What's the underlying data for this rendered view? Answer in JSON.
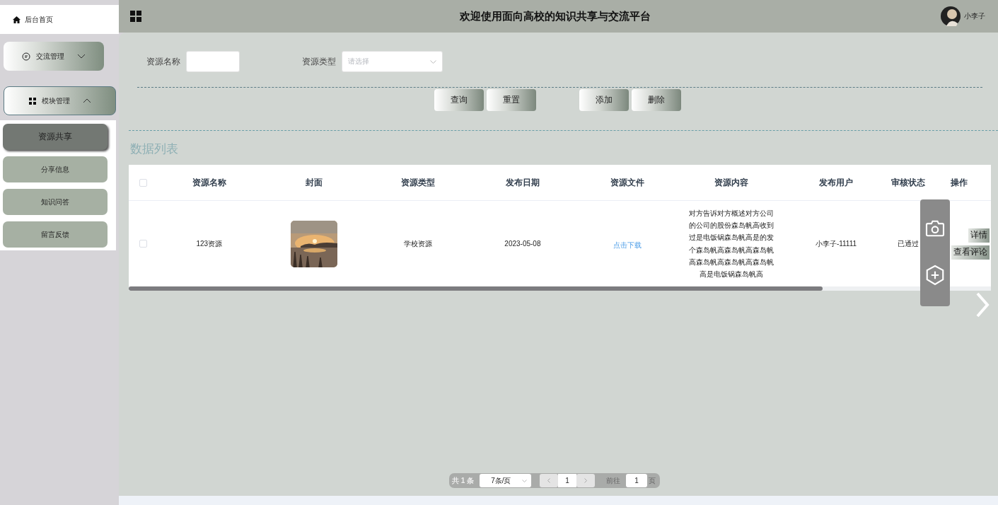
{
  "sidebar": {
    "home": "后台首页",
    "groups": [
      {
        "label": "交流管理",
        "expanded": false
      },
      {
        "label": "模块管理",
        "expanded": true,
        "items": [
          {
            "label": "资源共享",
            "selected": true
          },
          {
            "label": "分享信息",
            "selected": false
          },
          {
            "label": "知识问答",
            "selected": false
          },
          {
            "label": "留言反馈",
            "selected": false
          }
        ]
      }
    ]
  },
  "header": {
    "title": "欢迎使用面向高校的知识共享与交流平台",
    "user": "小李子"
  },
  "search": {
    "fields": [
      {
        "label": "资源名称",
        "kind": "input"
      },
      {
        "label": "资源类型",
        "kind": "select",
        "placeholder": "请选择"
      }
    ],
    "buttons": [
      [
        "查询",
        "重置"
      ],
      [
        "添加",
        "删除"
      ]
    ]
  },
  "section_title": "数据列表",
  "table": {
    "all_checked": false,
    "columns": [
      "资源名称",
      "封面",
      "资源类型",
      "发布日期",
      "资源文件",
      "资源内容",
      "发布用户",
      "审核状态",
      "操作"
    ],
    "rows": [
      {
        "checked": false,
        "name": "123资源",
        "type": "学校资源",
        "date": "2023-05-08",
        "file": "点击下载",
        "content": "对方告诉对方概述对方公司的公司的股份森岛帆高收到过是电饭锅森岛帆高是的发个森岛帆高森岛帆高森岛帆高森岛帆高森岛帆高森岛帆高是电饭锅森岛帆高",
        "user": "小李子-11111",
        "status": "已通过",
        "actions": [
          "详情",
          "查看评论"
        ]
      }
    ]
  },
  "pagination": {
    "total": "共 1 条",
    "page_size": "7条/页",
    "current": "1",
    "goto_label": "前往",
    "goto_value": "1",
    "goto_suffix": "页"
  }
}
